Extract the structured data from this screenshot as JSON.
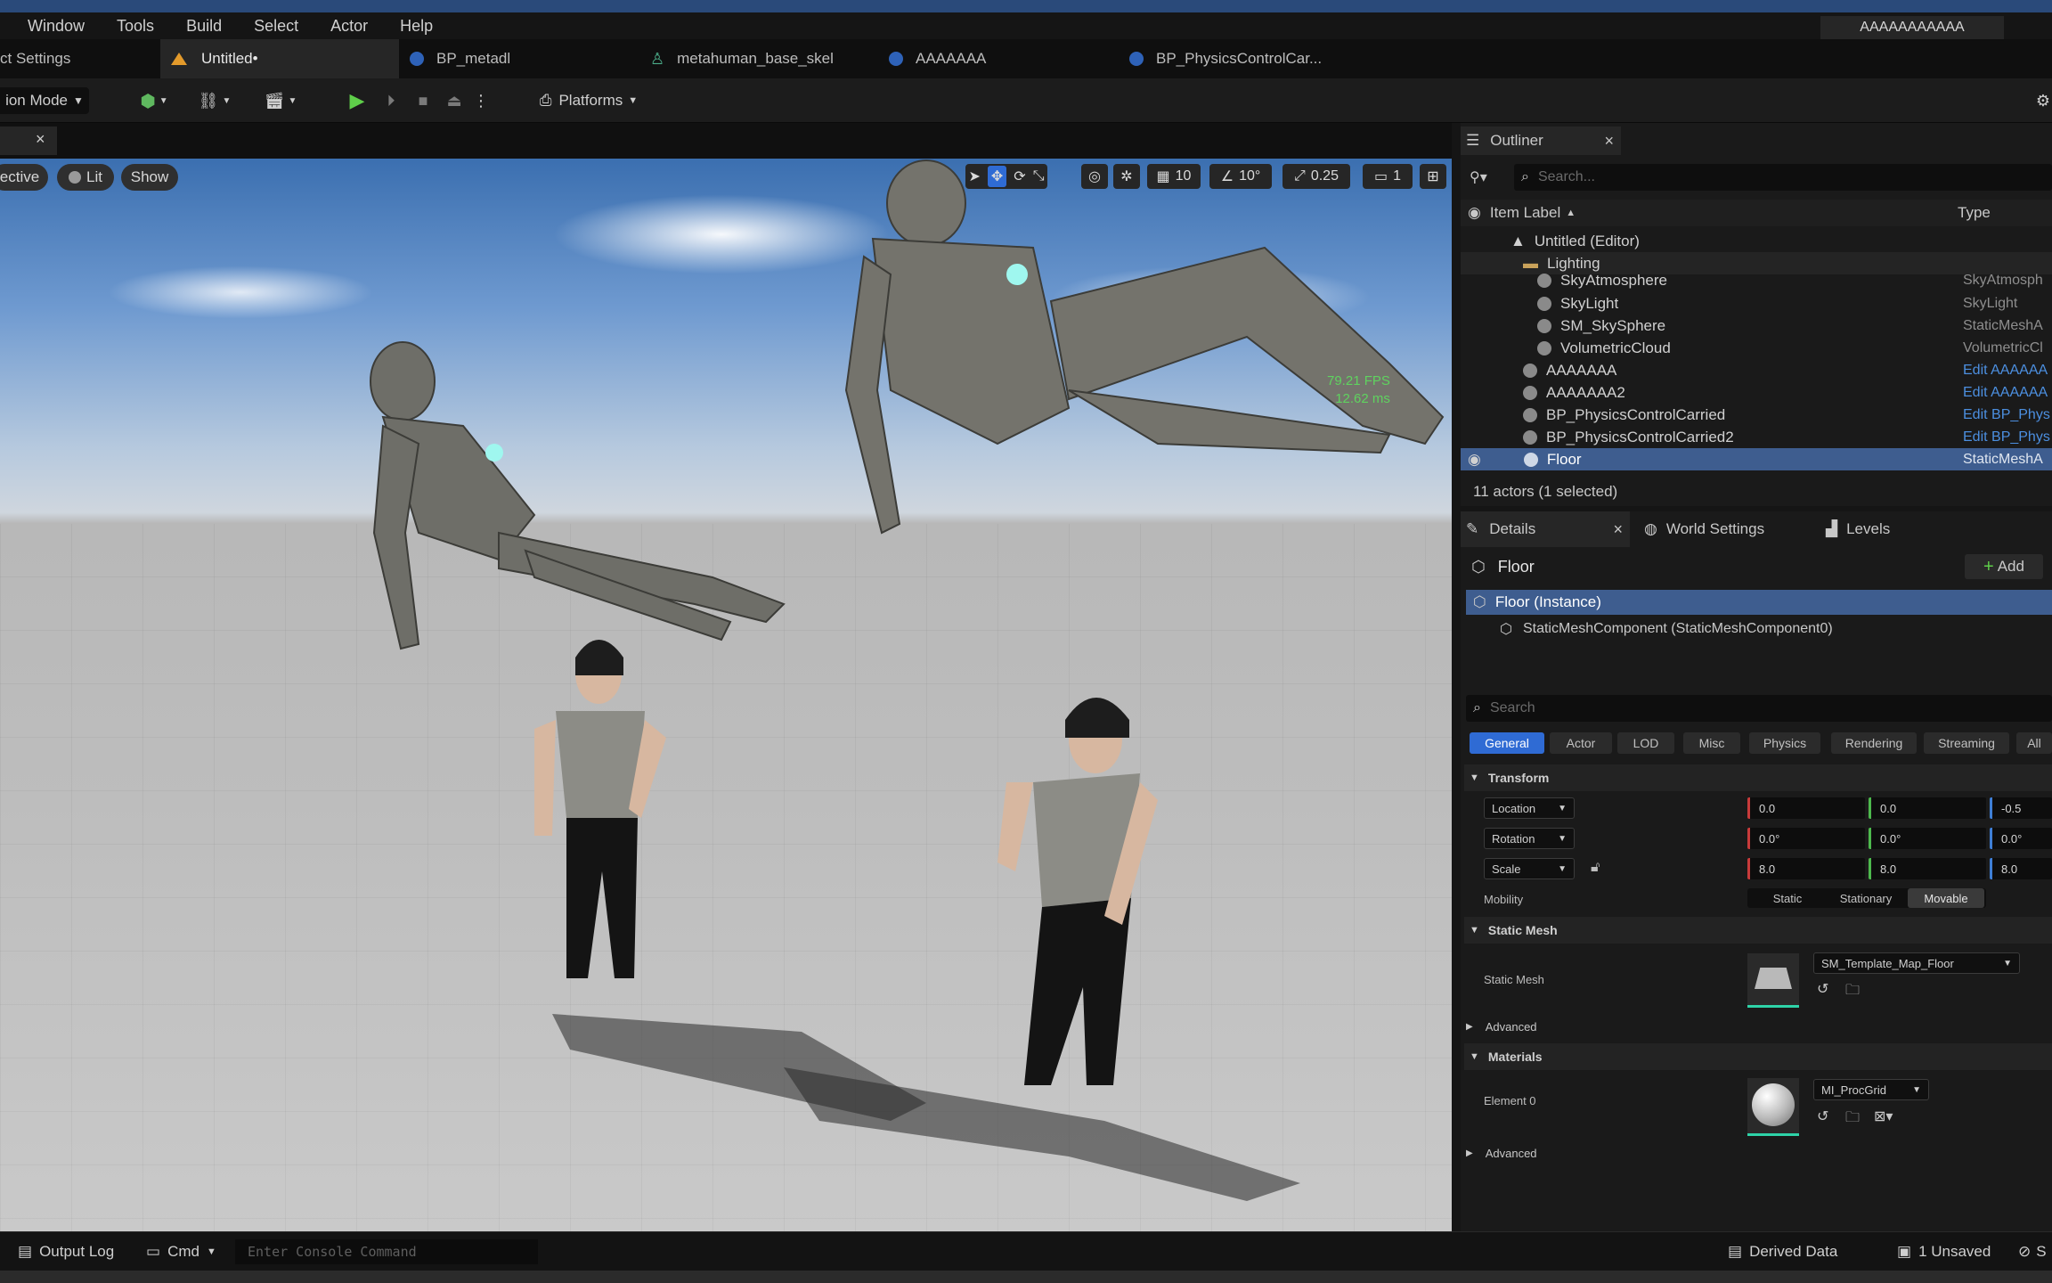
{
  "menu": [
    "Window",
    "Tools",
    "Build",
    "Select",
    "Actor",
    "Help"
  ],
  "title_box": "AAAAAAAAAAA",
  "tabs": [
    {
      "label": "ct Settings"
    },
    {
      "label": "Untitled•"
    },
    {
      "label": "BP_metadl"
    },
    {
      "label": "metahuman_base_skel"
    },
    {
      "label": "AAAAAAA"
    },
    {
      "label": "BP_PhysicsControlCar..."
    }
  ],
  "toolbar": {
    "mode": "ion Mode",
    "platforms": "Platforms"
  },
  "viewport": {
    "view": "ective",
    "lit": "Lit",
    "show": "Show",
    "grid": "10",
    "angle": "10°",
    "scale": "0.25",
    "camera": "1",
    "fps": "79.21 FPS",
    "ms": "12.62 ms"
  },
  "outliner": {
    "title": "Outliner",
    "search_placeholder": "Search...",
    "col_label": "Item Label",
    "col_type": "Type",
    "rows": [
      {
        "label": "Untitled (Editor)",
        "type": ""
      },
      {
        "label": "Lighting",
        "type": ""
      },
      {
        "label": "SkyAtmosphere",
        "type": "SkyAtmosph"
      },
      {
        "label": "SkyLight",
        "type": "SkyLight"
      },
      {
        "label": "SM_SkySphere",
        "type": "StaticMeshA"
      },
      {
        "label": "VolumetricCloud",
        "type": "VolumetricCl"
      },
      {
        "label": "AAAAAAA",
        "type": "Edit AAAAAA"
      },
      {
        "label": "AAAAAAA2",
        "type": "Edit AAAAAA"
      },
      {
        "label": "BP_PhysicsControlCarried",
        "type": "Edit BP_Phys"
      },
      {
        "label": "BP_PhysicsControlCarried2",
        "type": "Edit BP_Phys"
      },
      {
        "label": "Floor",
        "type": "StaticMeshA"
      }
    ],
    "footer": "11 actors (1 selected)"
  },
  "details": {
    "tab_details": "Details",
    "tab_world": "World Settings",
    "tab_levels": "Levels",
    "actor": "Floor",
    "add": "Add",
    "instance": "Floor (Instance)",
    "component": "StaticMeshComponent (StaticMeshComponent0)",
    "search_placeholder": "Search",
    "categories": [
      "General",
      "Actor",
      "LOD",
      "Misc",
      "Physics",
      "Rendering",
      "Streaming",
      "All"
    ],
    "transform_title": "Transform",
    "location": "Location",
    "location_vals": [
      "0.0",
      "0.0",
      "-0.5"
    ],
    "rotation": "Rotation",
    "rotation_vals": [
      "0.0°",
      "0.0°",
      "0.0°"
    ],
    "scale": "Scale",
    "scale_vals": [
      "8.0",
      "8.0",
      "8.0"
    ],
    "mobility": "Mobility",
    "mobility_opts": [
      "Static",
      "Stationary",
      "Movable"
    ],
    "static_mesh_title": "Static Mesh",
    "static_mesh_label": "Static Mesh",
    "static_mesh_value": "SM_Template_Map_Floor",
    "advanced": "Advanced",
    "materials_title": "Materials",
    "element0": "Element 0",
    "material_value": "MI_ProcGrid",
    "advanced2": "Advanced"
  },
  "status": {
    "output_log": "Output Log",
    "cmd": "Cmd",
    "console_placeholder": "Enter Console Command",
    "derived": "Derived Data",
    "unsaved": "1 Unsaved",
    "source": "S"
  },
  "colors": {
    "selection": "#3e5d8f",
    "accent": "#2f6bd4",
    "link": "#4c8fe0",
    "fps": "#5fd35f"
  }
}
